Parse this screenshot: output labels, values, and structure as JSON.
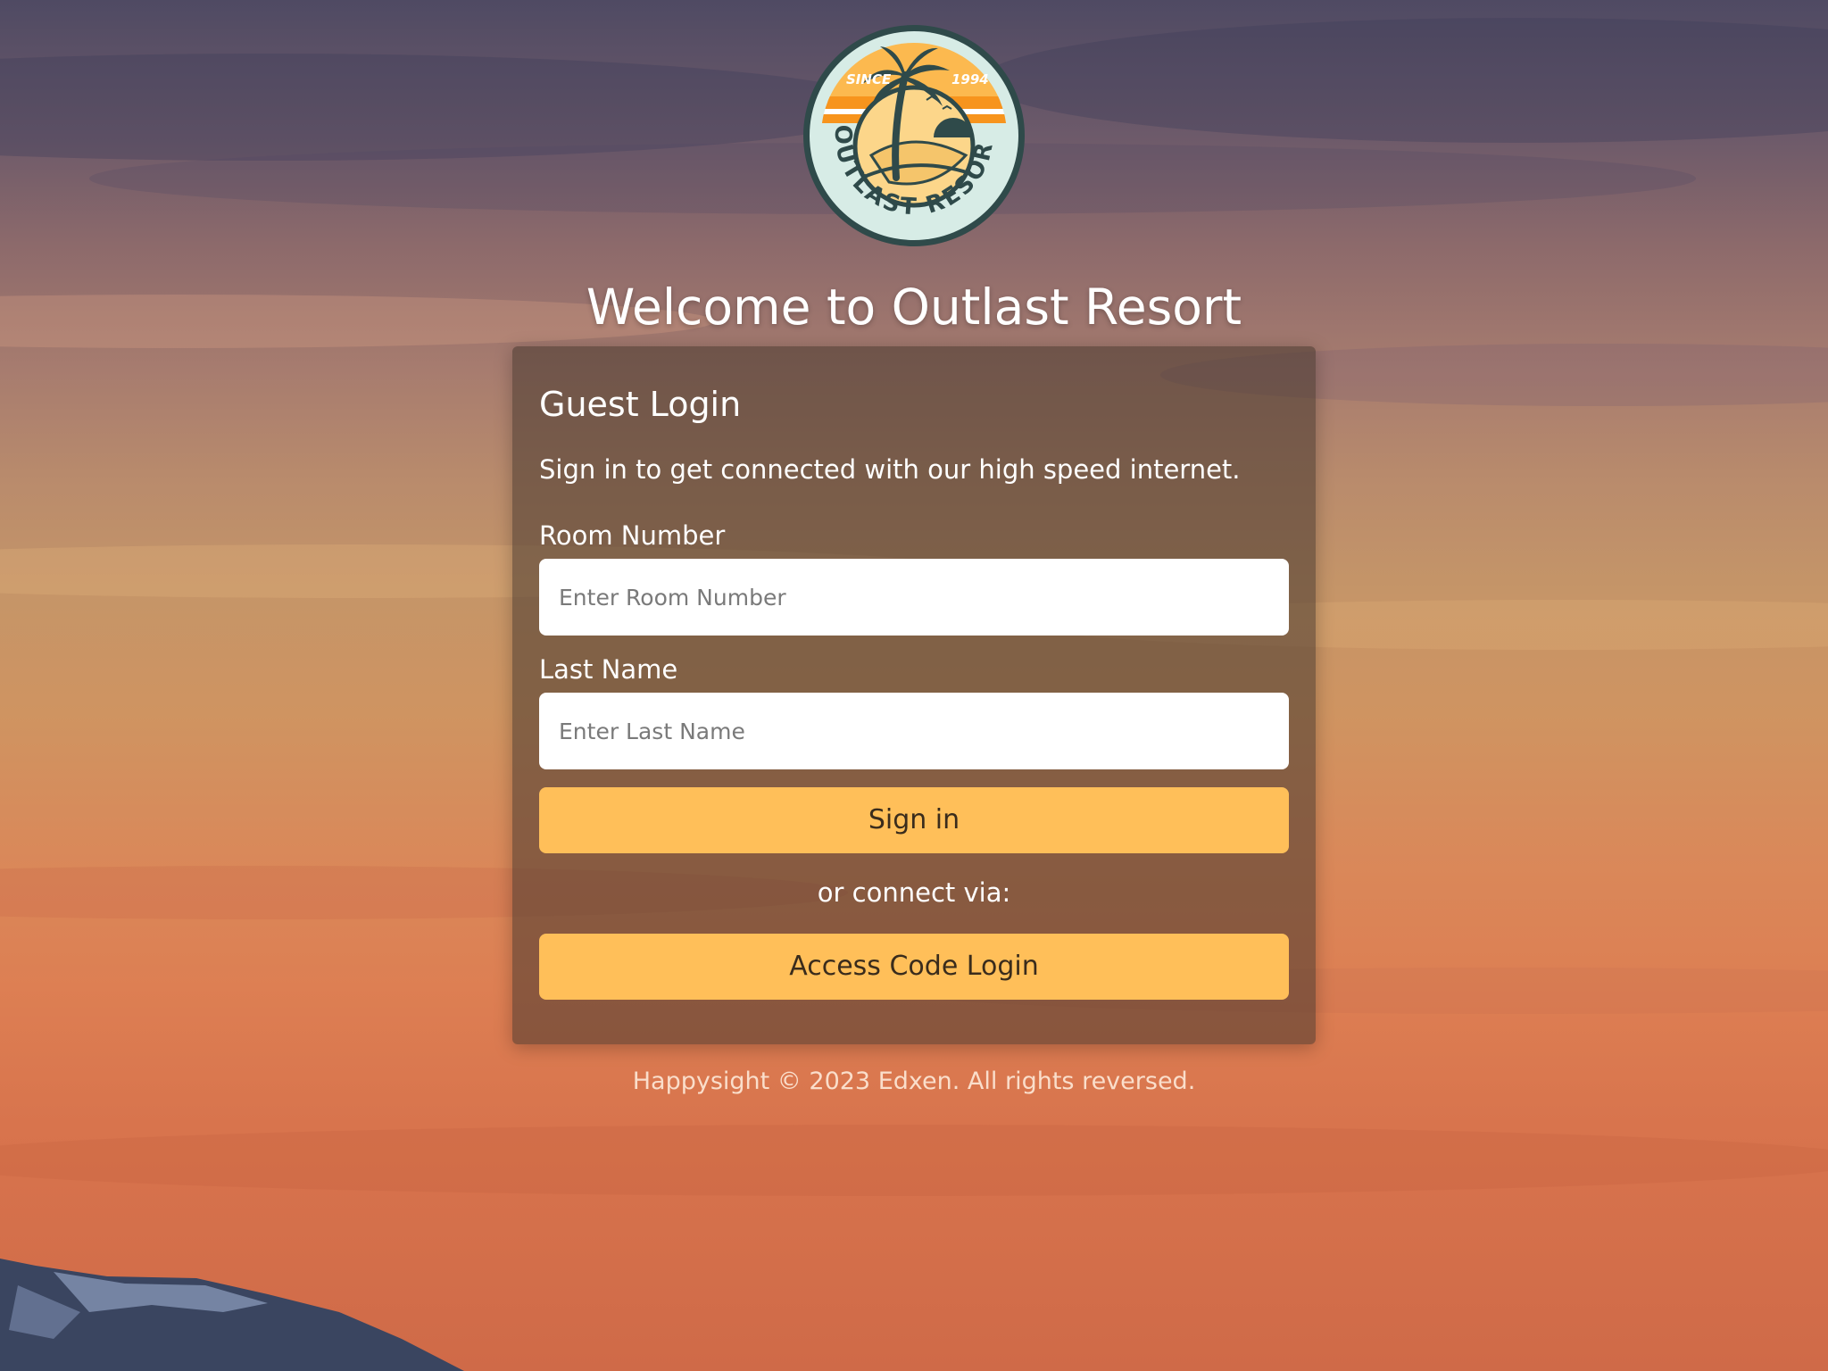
{
  "logo": {
    "top_text": [
      "SINCE",
      "1994"
    ],
    "ring_text": "OUTLAST RESORT",
    "icon": "palm-tree-sunset-icon"
  },
  "welcome": {
    "title": "Welcome to Outlast Resort"
  },
  "login_card": {
    "title": "Guest Login",
    "subtitle": "Sign in to get connected with our high speed internet.",
    "room_number": {
      "label": "Room Number",
      "placeholder": "Enter Room Number",
      "value": ""
    },
    "last_name": {
      "label": "Last Name",
      "placeholder": "Enter Last Name",
      "value": ""
    },
    "sign_in_label": "Sign in",
    "connect_via_label": "or connect via:",
    "access_code_label": "Access Code Login"
  },
  "footer": {
    "text": "Happysight © 2023 Edxen. All rights reversed."
  },
  "colors": {
    "button": "#ffbf59",
    "button_text": "#3a2c1c",
    "card_bg": "rgba(70,55,45,0.55)",
    "logo_dark": "#2f4a4a",
    "logo_orange": "#f7941d",
    "logo_yellow": "#fcd68a",
    "logo_mint": "#d7ece6"
  }
}
